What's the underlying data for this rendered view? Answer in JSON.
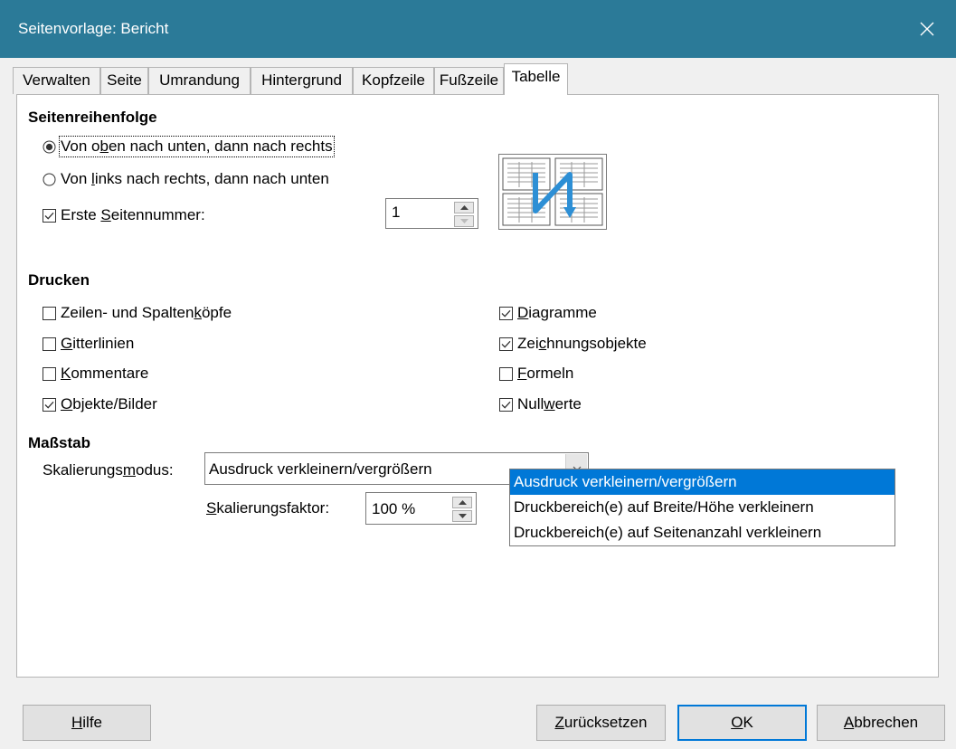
{
  "window": {
    "title": "Seitenvorlage: Bericht"
  },
  "tabs": [
    {
      "label": "Verwalten"
    },
    {
      "label": "Seite"
    },
    {
      "label": "Umrandung"
    },
    {
      "label": "Hintergrund"
    },
    {
      "label": "Kopfzeile"
    },
    {
      "label": "Fußzeile"
    },
    {
      "label": "Tabelle"
    }
  ],
  "seitenreihenfolge": {
    "heading": "Seitenreihenfolge",
    "option_top_down": {
      "pre": "Von o",
      "key": "b",
      "post": "en nach unten, dann nach rechts",
      "selected": true
    },
    "option_left_right": {
      "pre": "Von ",
      "key": "l",
      "post": "inks nach rechts, dann nach unten",
      "selected": false
    },
    "first_page": {
      "pre": "Erste ",
      "key": "S",
      "post": "eitennummer:",
      "checked": true,
      "value": "1"
    }
  },
  "drucken": {
    "heading": "Drucken",
    "left": [
      {
        "pre": "Zeilen- und Spalten",
        "key": "k",
        "post": "öpfe",
        "checked": false
      },
      {
        "pre": "",
        "key": "G",
        "post": "itterlinien",
        "checked": false
      },
      {
        "pre": "",
        "key": "K",
        "post": "ommentare",
        "checked": false
      },
      {
        "pre": "",
        "key": "O",
        "post": "bjekte/Bilder",
        "checked": true
      }
    ],
    "right": [
      {
        "pre": "",
        "key": "D",
        "post": "iagramme",
        "checked": true
      },
      {
        "pre": "Zei",
        "key": "c",
        "post": "hnungsobjekte",
        "checked": true
      },
      {
        "pre": "",
        "key": "F",
        "post": "ormeln",
        "checked": false
      },
      {
        "pre": "Null",
        "key": "w",
        "post": "erte",
        "checked": true
      }
    ]
  },
  "massstab": {
    "heading": "Maßstab",
    "mode_label": {
      "pre": "Skalierungs",
      "key": "m",
      "post": "odus:"
    },
    "mode_value": "Ausdruck verkleinern/vergrößern",
    "factor_label": {
      "pre": "",
      "key": "S",
      "post": "kalierungsfaktor:"
    },
    "factor_value": "100 %",
    "options": [
      "Ausdruck verkleinern/vergrößern",
      "Druckbereich(e) auf Breite/Höhe verkleinern",
      "Druckbereich(e) auf Seitenanzahl verkleinern"
    ]
  },
  "buttons": {
    "help": {
      "pre": "",
      "key": "H",
      "post": "ilfe"
    },
    "reset": {
      "pre": "",
      "key": "Z",
      "post": "urücksetzen"
    },
    "ok": {
      "pre": "",
      "key": "O",
      "post": "K"
    },
    "cancel": {
      "pre": "",
      "key": "A",
      "post": "bbrechen"
    }
  },
  "icons": {
    "close": "close-icon",
    "radio_on": "radio-checked-icon",
    "radio_off": "radio-unchecked-icon",
    "checkbox_on": "checkbox-checked-icon",
    "checkbox_off": "checkbox-unchecked-icon",
    "spin_up": "spin-up-icon",
    "spin_down": "spin-down-icon",
    "dropdown": "chevron-down-icon",
    "page_order": "page-order-top-down-icon"
  },
  "colors": {
    "titlebar": "#2b7a98",
    "selection": "#0078d7",
    "preview_arrow": "#2d8fd5"
  }
}
